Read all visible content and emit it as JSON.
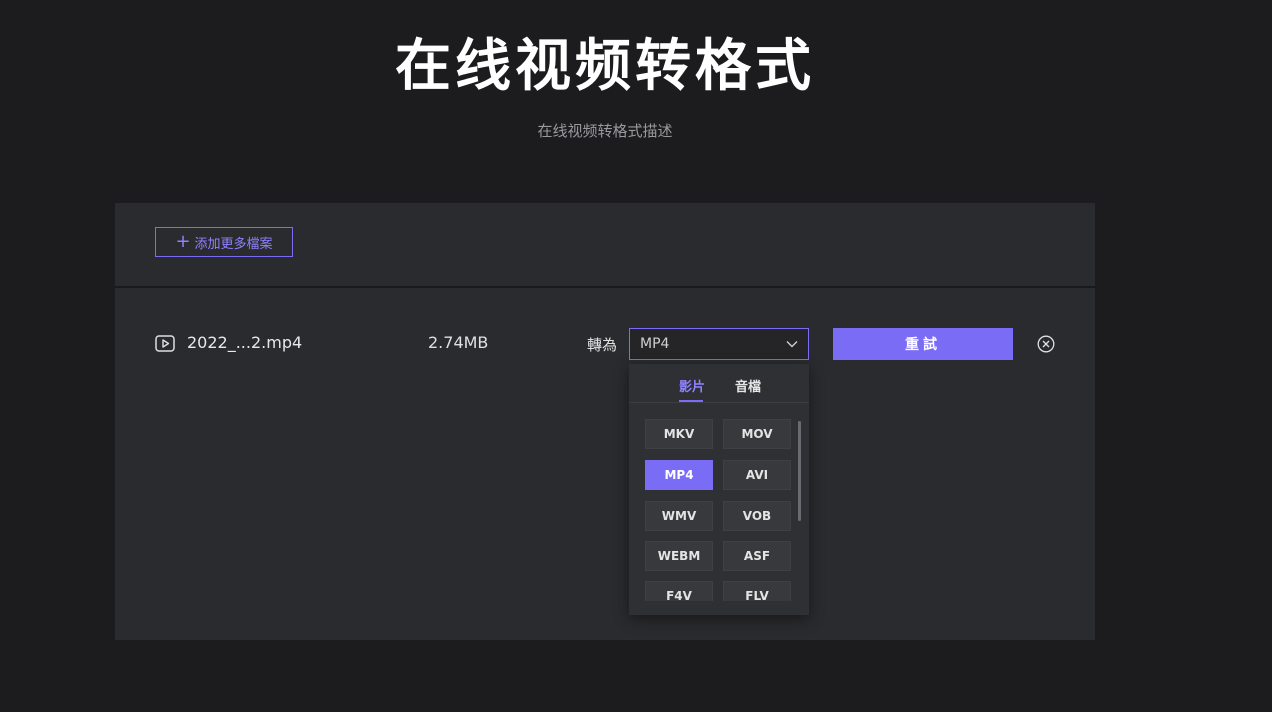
{
  "page": {
    "title": "在线视频转格式",
    "subtitle": "在线视频转格式描述"
  },
  "toolbar": {
    "add_files_label": "添加更多檔案"
  },
  "file": {
    "name": "2022_...2.mp4",
    "size": "2.74MB",
    "convert_to_label": "轉為",
    "selected_format": "MP4",
    "retry_label": "重試"
  },
  "dropdown": {
    "tabs": [
      {
        "label": "影片",
        "active": true
      },
      {
        "label": "音檔",
        "active": false
      }
    ],
    "formats": [
      "MKV",
      "MOV",
      "MP4",
      "AVI",
      "WMV",
      "VOB",
      "WEBM",
      "ASF",
      "F4V",
      "FLV"
    ],
    "selected": "MP4"
  },
  "icons": {
    "add": "plus-icon",
    "file": "play-icon",
    "select": "chevron-down-icon",
    "remove": "close-circle-icon"
  },
  "colors": {
    "accent": "#7b6cf6",
    "background": "#1c1c1e",
    "panel": "#2a2b2e"
  }
}
